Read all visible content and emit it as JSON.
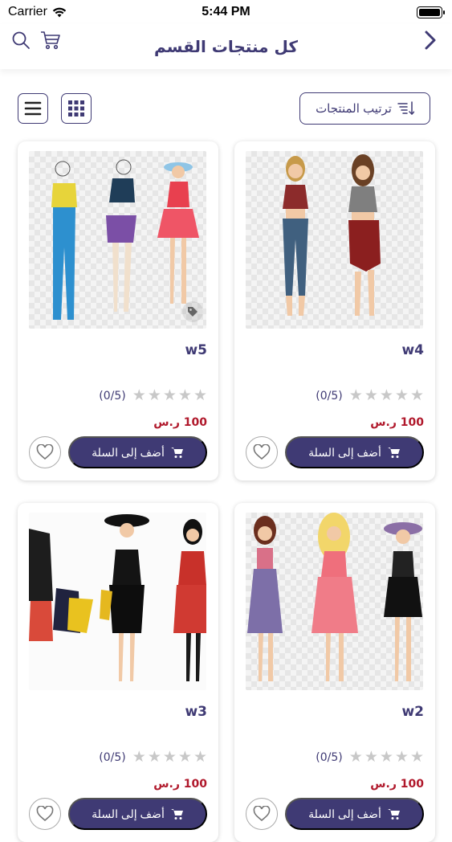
{
  "status_bar": {
    "carrier": "Carrier",
    "time": "5:44 PM"
  },
  "header": {
    "title": "كل منتجات القسم"
  },
  "toolbar": {
    "sort_label": "ترتيب المنتجات"
  },
  "products": [
    {
      "name": "w4",
      "rating": "(0/5)",
      "price": "100 ر.س",
      "add_label": "أضف إلى السلة"
    },
    {
      "name": "w5",
      "rating": "(0/5)",
      "price": "100 ر.س",
      "add_label": "أضف إلى السلة"
    },
    {
      "name": "w2",
      "rating": "(0/5)",
      "price": "100 ر.س",
      "add_label": "أضف إلى السلة"
    },
    {
      "name": "w3",
      "rating": "(0/5)",
      "price": "100 ر.س",
      "add_label": "أضف إلى السلة"
    }
  ],
  "colors": {
    "brand": "#3f3a74",
    "price": "#b0182b",
    "star_empty": "#c8c8c8"
  },
  "icons": [
    "search-icon",
    "cart-icon",
    "back-arrow-icon",
    "list-view-icon",
    "grid-view-icon",
    "sort-icon",
    "heart-icon",
    "tag-icon"
  ]
}
